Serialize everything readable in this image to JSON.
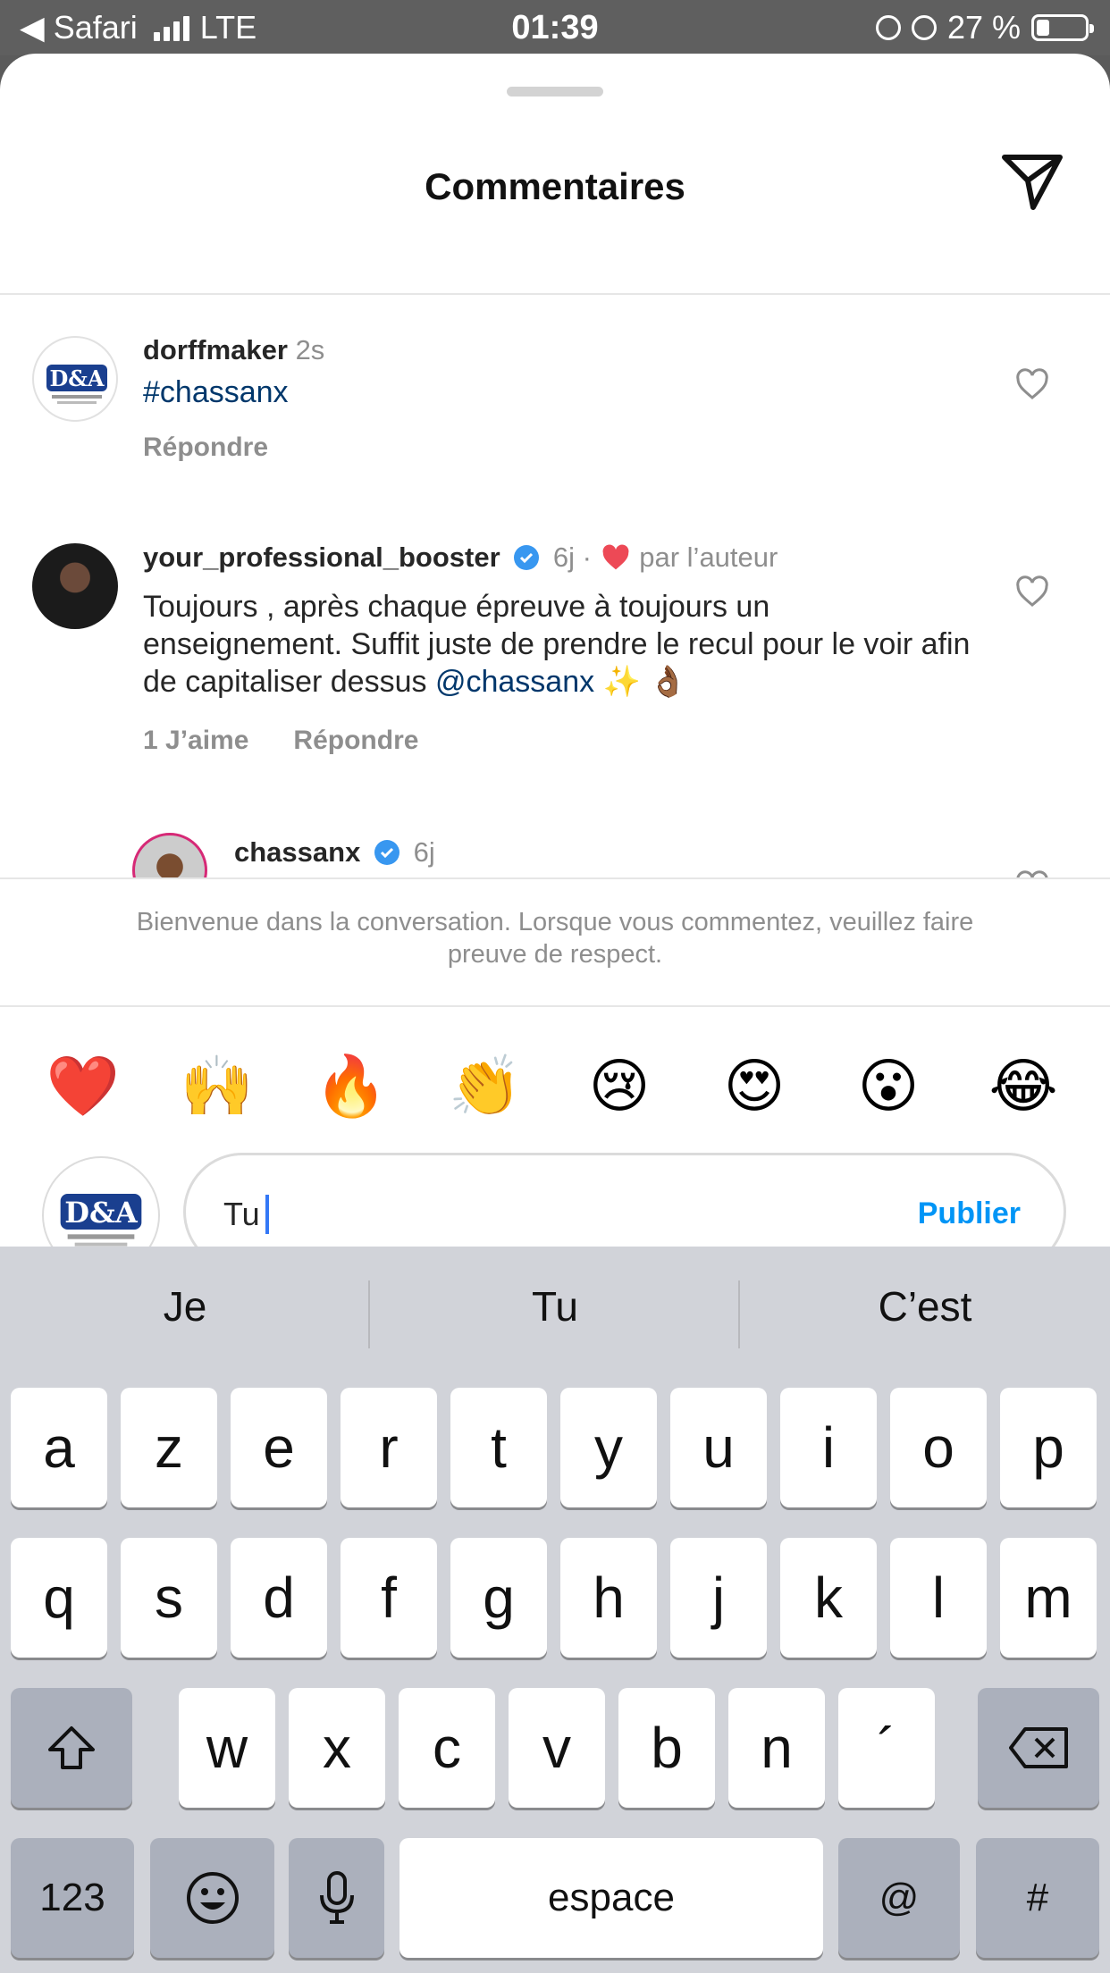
{
  "status_bar": {
    "back_label": "◀ Safari",
    "network": "LTE",
    "time": "01:39",
    "battery_text": "27 %",
    "battery_level": 0.27
  },
  "header": {
    "title": "Commentaires"
  },
  "comments": [
    {
      "username": "dorffmaker",
      "time": "2s",
      "text": "#chassanx",
      "actions": [
        "Répondre"
      ],
      "avatar": "logo"
    },
    {
      "username": "your_professional_booster",
      "verified": true,
      "time": "6j",
      "separator": "·",
      "liked_by_author": "par l’auteur",
      "text_main": "Toujours , après chaque épreuve à toujours un enseignement. Suffit juste de prendre le recul pour le voir afin de capitaliser dessus ",
      "text_mention": "@chassanx",
      "text_emoji": " ✨ 👌🏾",
      "likes": "1 J’aime",
      "reply": "Répondre",
      "avatar": "photo"
    },
    {
      "username": "chassanx",
      "verified": true,
      "time": "6j",
      "avatar": "photo-story"
    }
  ],
  "welcome": "Bienvenue dans la conversation. Lorsque vous commentez, veuillez faire preuve de respect.",
  "emojis": [
    "❤️",
    "🙌",
    "🔥",
    "👏",
    "😢",
    "😍",
    "😮",
    "😂"
  ],
  "composer": {
    "value": "Tu",
    "publish": "Publier"
  },
  "keyboard": {
    "suggestions": [
      "Je",
      "Tu",
      "C’est"
    ],
    "row1": [
      "a",
      "z",
      "e",
      "r",
      "t",
      "y",
      "u",
      "i",
      "o",
      "p"
    ],
    "row2": [
      "q",
      "s",
      "d",
      "f",
      "g",
      "h",
      "j",
      "k",
      "l",
      "m"
    ],
    "row3": [
      "w",
      "x",
      "c",
      "v",
      "b",
      "n",
      "´"
    ],
    "numbers_key": "123",
    "space_key": "espace",
    "at_key": "@",
    "hash_key": "#"
  },
  "colors": {
    "link": "#00376b",
    "publish": "#0095f6",
    "verified": "#3897f0",
    "heart": "#ed4956"
  },
  "icons": [
    "send-icon",
    "heart-outline-icon",
    "verified-badge-icon",
    "shift-icon",
    "backspace-icon",
    "emoji-icon",
    "microphone-icon"
  ]
}
